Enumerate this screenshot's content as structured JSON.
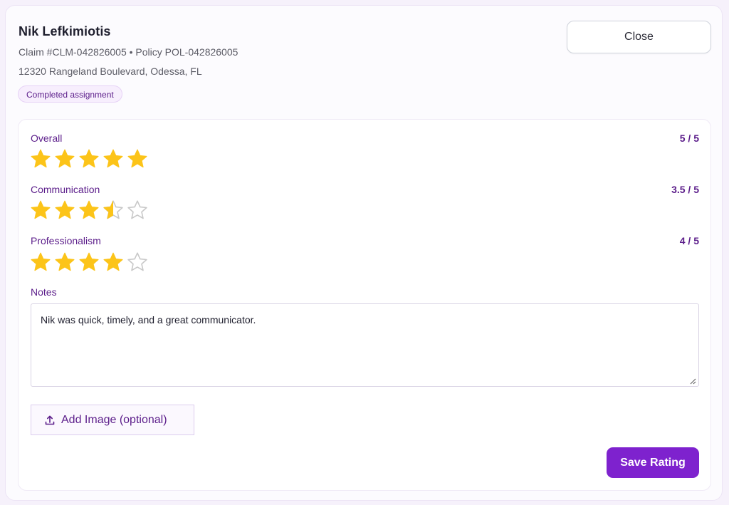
{
  "header": {
    "name": "Nik Lefkimiotis",
    "claim_line": "Claim #CLM-042826005 • Policy POL-042826005",
    "address": "12320 Rangeland Boulevard, Odessa, FL",
    "status_badge": "Completed assignment",
    "close_label": "Close"
  },
  "ratings": [
    {
      "label": "Overall",
      "score_text": "5 / 5",
      "value": 5
    },
    {
      "label": "Communication",
      "score_text": "3.5 / 5",
      "value": 3.5
    },
    {
      "label": "Professionalism",
      "score_text": "4 / 5",
      "value": 4
    }
  ],
  "notes": {
    "label": "Notes",
    "value": "Nik was quick, timely, and a great communicator."
  },
  "add_image_label": "Add Image (optional)",
  "save_label": "Save Rating",
  "colors": {
    "accent": "#7e22ce",
    "label_purple": "#5b1d8a",
    "star_filled": "#fcc419",
    "star_empty_stroke": "#c8c8c8"
  }
}
